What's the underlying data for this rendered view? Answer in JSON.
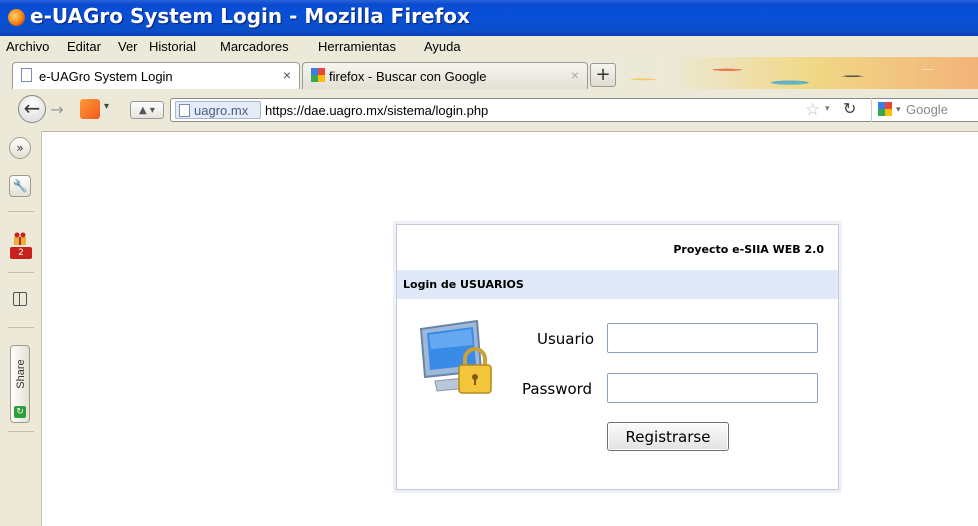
{
  "window": {
    "title": "e-UAGro System Login - Mozilla Firefox"
  },
  "menu": [
    "Archivo",
    "Editar",
    "Ver",
    "Historial",
    "Marcadores",
    "Herramientas",
    "Ayuda"
  ],
  "tabs": [
    {
      "label": "e-UAGro System Login",
      "close": "×",
      "active": true
    },
    {
      "label": "firefox - Buscar con Google",
      "close": "×",
      "active": false
    }
  ],
  "new_tab_symbol": "+",
  "navbar": {
    "identity_label": "uagro.mx",
    "url": "https://dae.uagro.mx/sistema/login.php",
    "search_placeholder": "Google"
  },
  "sidebar": {
    "expand_symbol": "»",
    "badge_count": "2",
    "share_label": "Share"
  },
  "login": {
    "project_label": "Proyecto e-SIIA WEB 2.0",
    "section_title": "Login de USUARIOS",
    "user_label": "Usuario",
    "user_value": "",
    "password_label": "Password",
    "password_value": "",
    "submit_label": "Registrarse"
  },
  "colors": {
    "titlebar": "#0650d9",
    "chrome_bg": "#ece9d8",
    "section_header_bg": "#dfe9f8",
    "input_border": "#8aa0c4"
  }
}
